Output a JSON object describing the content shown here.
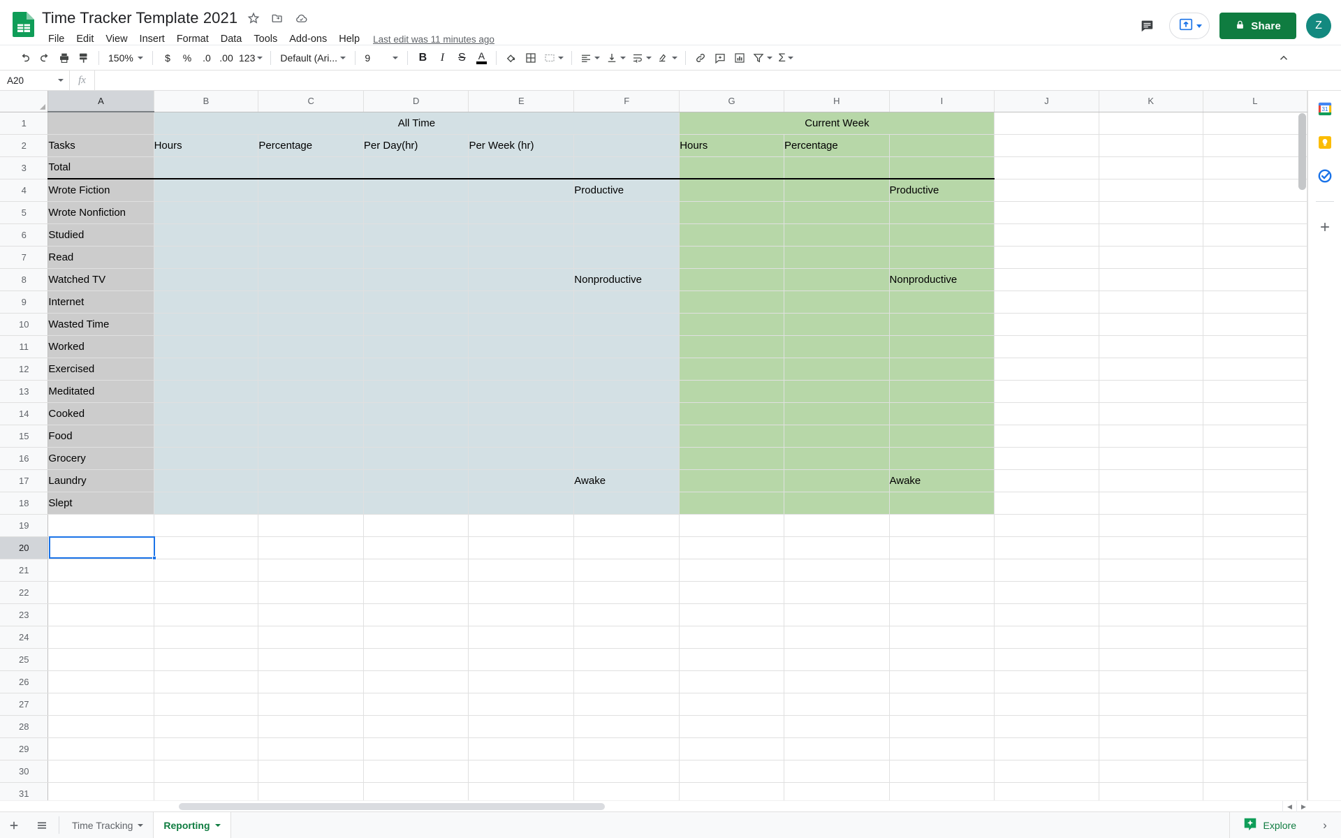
{
  "app": {
    "title": "Time Tracker Template 2021",
    "logo_icon": "sheets-logo-icon",
    "title_icons": [
      "star-icon",
      "move-to-folder-icon",
      "cloud-saved-icon"
    ],
    "last_edit": "Last edit was 11 minutes ago",
    "menu": [
      "File",
      "Edit",
      "View",
      "Insert",
      "Format",
      "Data",
      "Tools",
      "Add-ons",
      "Help"
    ],
    "comment_icon": "comment-history-icon",
    "present_label": "",
    "present_icon": "present-upload-icon",
    "share_label": "Share",
    "share_icon": "lock-icon",
    "avatar_initial": "Z",
    "accent_green": "#0f7c40",
    "accent_blue": "#1a73e8",
    "avatar_color": "#13897f"
  },
  "toolbar": {
    "undo_icon": "undo-icon",
    "redo_icon": "redo-icon",
    "print_icon": "print-icon",
    "paint_icon": "paint-format-icon",
    "zoom_value": "150%",
    "currency_label": "$",
    "percent_label": "%",
    "decrease_decimal_label": ".0",
    "increase_decimal_label": ".00",
    "number_format_label": "123",
    "font_name": "Default (Ari...",
    "font_size": "9",
    "bold_label": "B",
    "italic_label": "I",
    "strikethrough_label": "S",
    "text_color_label": "A",
    "fill_icon": "fill-color-icon",
    "borders_icon": "borders-icon",
    "merge_icon": "merge-cells-icon",
    "halign_icon": "horizontal-align-icon",
    "valign_icon": "vertical-align-icon",
    "wrap_icon": "text-wrap-icon",
    "rotate_icon": "text-rotation-icon",
    "link_icon": "insert-link-icon",
    "comment_icon": "insert-comment-icon",
    "chart_icon": "insert-chart-icon",
    "filter_icon": "filter-icon",
    "functions_label": "Σ",
    "collapse_icon": "collapse-toolbar-icon"
  },
  "formula_bar": {
    "name_box": "A20",
    "fx_label": "fx",
    "formula_value": ""
  },
  "grid": {
    "columns": [
      "A",
      "B",
      "C",
      "D",
      "E",
      "F",
      "G",
      "H",
      "I",
      "J",
      "K",
      "L"
    ],
    "selected_column": "A",
    "selected_cell": "A20",
    "rows": [
      1,
      2,
      3,
      4,
      5,
      6,
      7,
      8,
      9,
      10,
      11,
      12,
      13,
      14,
      15,
      16,
      17,
      18,
      19,
      20,
      21,
      22,
      23,
      24,
      25,
      26,
      27,
      28,
      29,
      30,
      31
    ],
    "colors": {
      "all_time_fill": "#d3e0e4",
      "current_week_fill": "#b7d7a8",
      "selected_header_fill": "#cccccc"
    },
    "banner": {
      "all_time": "All Time",
      "current_week": "Current Week"
    },
    "headers": {
      "tasks": "Tasks",
      "alltime_hours": "Hours",
      "alltime_percentage": "Percentage",
      "alltime_per_day": "Per Day(hr)",
      "alltime_per_week": "Per Week (hr)",
      "alltime_blank": "",
      "week_hours": "Hours",
      "week_percentage": "Percentage",
      "week_blank": ""
    },
    "total_label": "Total",
    "tasks": [
      {
        "row": 4,
        "name": "Wrote Fiction",
        "f": "Productive",
        "i": "Productive"
      },
      {
        "row": 5,
        "name": "Wrote Nonfiction",
        "f": "",
        "i": ""
      },
      {
        "row": 6,
        "name": "Studied",
        "f": "",
        "i": ""
      },
      {
        "row": 7,
        "name": "Read",
        "f": "",
        "i": ""
      },
      {
        "row": 8,
        "name": "Watched TV",
        "f": "Nonproductive",
        "i": "Nonproductive"
      },
      {
        "row": 9,
        "name": "Internet",
        "f": "",
        "i": ""
      },
      {
        "row": 10,
        "name": "Wasted Time",
        "f": "",
        "i": ""
      },
      {
        "row": 11,
        "name": "Worked",
        "f": "",
        "i": ""
      },
      {
        "row": 12,
        "name": "Exercised",
        "f": "",
        "i": ""
      },
      {
        "row": 13,
        "name": "Meditated",
        "f": "",
        "i": ""
      },
      {
        "row": 14,
        "name": "Cooked",
        "f": "",
        "i": ""
      },
      {
        "row": 15,
        "name": "Food",
        "f": "",
        "i": ""
      },
      {
        "row": 16,
        "name": "Grocery",
        "f": "",
        "i": ""
      },
      {
        "row": 17,
        "name": "Laundry",
        "f": "Awake",
        "i": "Awake"
      },
      {
        "row": 18,
        "name": "Slept",
        "f": "",
        "i": ""
      }
    ]
  },
  "side_panel": {
    "items": [
      {
        "name": "google-calendar-icon",
        "label": "Calendar"
      },
      {
        "name": "google-keep-icon",
        "label": "Keep"
      },
      {
        "name": "google-tasks-icon",
        "label": "Tasks"
      },
      {
        "name": "add-ons-icon",
        "label": "+"
      }
    ]
  },
  "bottom_bar": {
    "add_sheet_icon": "add-sheet-icon",
    "all_sheets_icon": "all-sheets-icon",
    "tabs": [
      {
        "label": "Time Tracking",
        "active": false
      },
      {
        "label": "Reporting",
        "active": true
      }
    ],
    "explore_label": "Explore",
    "explore_icon": "explore-sparkle-icon",
    "expand_icon": "expand-panel-icon"
  }
}
